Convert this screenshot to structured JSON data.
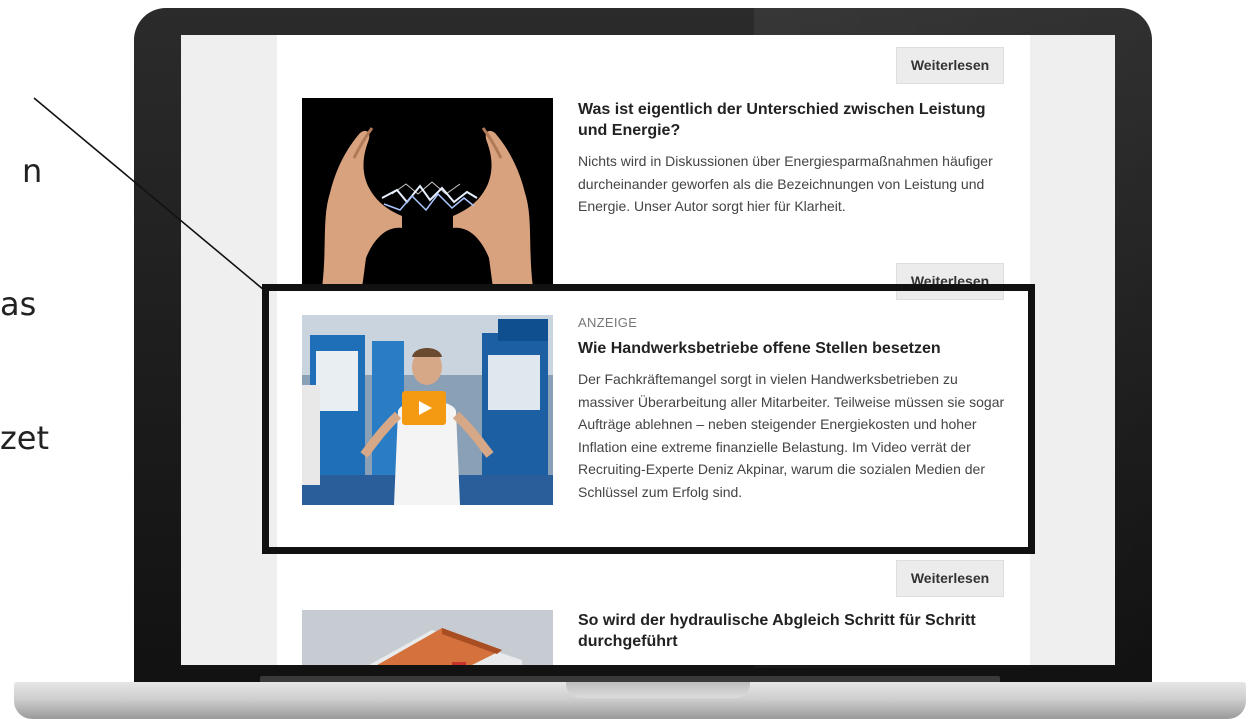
{
  "slide_fragments": [
    "n",
    "as",
    "zet"
  ],
  "articles": [
    {
      "title": "Was ist eigentlich der Unterschied zwischen Leistung und Energie?",
      "summary": "Nichts wird in Diskussionen über Energiesparmaßnahmen häufiger durcheinander geworfen als die Bezeichnungen von Leistung und Energie. Unser Autor sorgt hier für Klarheit.",
      "image": "hands-electricity-photo"
    },
    {
      "label": "ANZEIGE",
      "title": "Wie Handwerksbetriebe offene Stellen besetzen",
      "summary": "Der Fachkräftemangel sorgt in vielen Handwerksbetrieben zu massiver Überarbeitung aller Mitarbeiter. Teilweise müssen sie sogar Aufträge ablehnen – neben steigender Energiekosten und hoher Inflation eine extreme finanzielle Belastung. Im Video verrät der Recruiting-Experte Deniz Akpinar, warum die sozialen Medien der Schlüssel zum Erfolg sind.",
      "image": "video-thumbnail-trade-fair",
      "play_icon": "play-icon"
    },
    {
      "title": "So wird der hydraulische Abgleich Schritt für Schritt durchgeführt",
      "image": "house-roof-illustration"
    }
  ],
  "read_more_label": "Weiterlesen",
  "colors": {
    "play_button": "#f39a12",
    "highlight_frame": "#111111",
    "button_bg": "#ececec"
  }
}
